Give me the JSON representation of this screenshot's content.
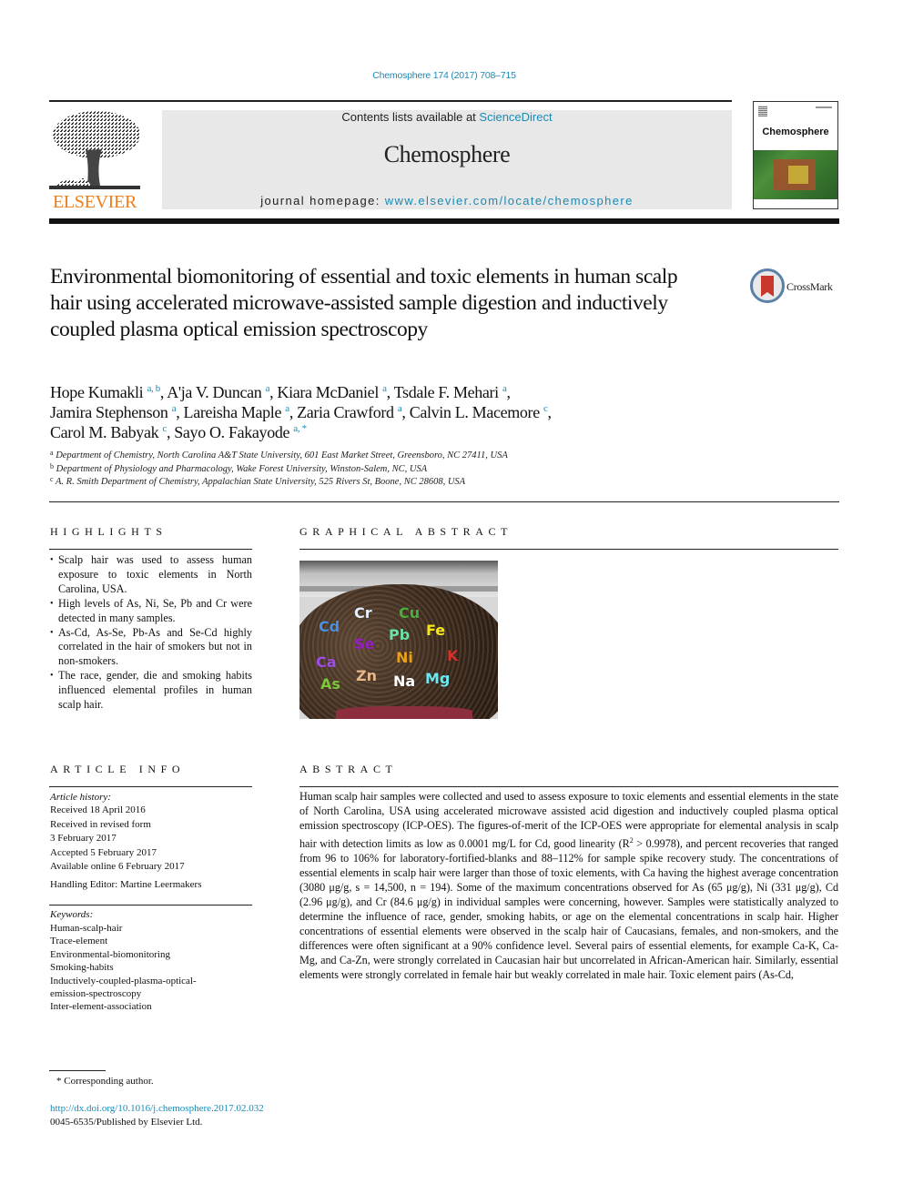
{
  "journal_ref": "Chemosphere 174 (2017) 708–715",
  "banner": {
    "publisher_logo_text": "ELSEVIER",
    "contents_prefix": "Contents lists available at ",
    "contents_link": "ScienceDirect",
    "journal_name": "Chemosphere",
    "homepage_prefix": "journal homepage: ",
    "homepage_link": "www.elsevier.com/locate/chemosphere",
    "cover_title": "Chemosphere"
  },
  "crossmark_label": "CrossMark",
  "article": {
    "title": "Environmental biomonitoring of essential and toxic elements in human scalp hair using accelerated microwave-assisted sample digestion and inductively coupled plasma optical emission spectroscopy",
    "authors": [
      {
        "name": "Hope Kumakli",
        "aff": "a, b",
        "sep": ", "
      },
      {
        "name": "A'ja V. Duncan",
        "aff": "a",
        "sep": ", "
      },
      {
        "name": "Kiara McDaniel",
        "aff": "a",
        "sep": ", "
      },
      {
        "name": "Tsdale F. Mehari",
        "aff": "a",
        "sep": ","
      },
      {
        "name": "Jamira Stephenson",
        "aff": "a",
        "sep": ", "
      },
      {
        "name": "Lareisha Maple",
        "aff": "a",
        "sep": ", "
      },
      {
        "name": "Zaria Crawford",
        "aff": "a",
        "sep": ", "
      },
      {
        "name": "Calvin L. Macemore",
        "aff": "c",
        "sep": ","
      },
      {
        "name": "Carol M. Babyak",
        "aff": "c",
        "sep": ", "
      },
      {
        "name": "Sayo O. Fakayode",
        "aff": "a, *",
        "sep": ""
      }
    ],
    "affiliations": [
      {
        "mark": "a",
        "text": "Department of Chemistry, North Carolina A&T State University, 601 East Market Street, Greensboro, NC 27411, USA"
      },
      {
        "mark": "b",
        "text": "Department of Physiology and Pharmacology, Wake Forest University, Winston-Salem, NC, USA"
      },
      {
        "mark": "c",
        "text": "A. R. Smith Department of Chemistry, Appalachian State University, 525 Rivers St, Boone, NC 28608, USA"
      }
    ]
  },
  "highlights": {
    "heading": "HIGHLIGHTS",
    "items": [
      "Scalp hair was used to assess human exposure to toxic elements in North Carolina, USA.",
      "High levels of As, Ni, Se, Pb and Cr were detected in many samples.",
      "As-Cd, As-Se, Pb-As and Se-Cd highly correlated in the hair of smokers but not in non-smokers.",
      "The race, gender, die and smoking habits influenced elemental profiles in human scalp hair."
    ]
  },
  "graphical_abstract": {
    "heading": "GRAPHICAL ABSTRACT",
    "element_labels": [
      {
        "symbol": "Cr",
        "color": "#e6f0ff"
      },
      {
        "symbol": "Cu",
        "color": "#4caf3c"
      },
      {
        "symbol": "Cd",
        "color": "#4a90e2"
      },
      {
        "symbol": "Fe",
        "color": "#f5e61a"
      },
      {
        "symbol": "Pb",
        "color": "#6ee0a8"
      },
      {
        "symbol": "Se",
        "color": "#9b1fc9"
      },
      {
        "symbol": "Ni",
        "color": "#e8a21a"
      },
      {
        "symbol": "K",
        "color": "#d8302a"
      },
      {
        "symbol": "Ca",
        "color": "#a04ee8"
      },
      {
        "symbol": "Zn",
        "color": "#e8b88a"
      },
      {
        "symbol": "Mg",
        "color": "#6ee8f0"
      },
      {
        "symbol": "Na",
        "color": "#ffffff"
      },
      {
        "symbol": "As",
        "color": "#7cc83a"
      }
    ]
  },
  "article_info": {
    "heading": "ARTICLE INFO",
    "history_label": "Article history:",
    "history": [
      "Received 18 April 2016",
      "Received in revised form",
      "3 February 2017",
      "Accepted 5 February 2017",
      "Available online 6 February 2017"
    ],
    "handling_editor": "Handling Editor: Martine Leermakers",
    "keywords_label": "Keywords:",
    "keywords": [
      "Human-scalp-hair",
      "Trace-element",
      "Environmental-biomonitoring",
      "Smoking-habits",
      "Inductively-coupled-plasma-optical-",
      "emission-spectroscopy",
      "Inter-element-association"
    ]
  },
  "abstract": {
    "heading": "ABSTRACT",
    "part1": "Human scalp hair samples were collected and used to assess exposure to toxic elements and essential elements in the state of North Carolina, USA using accelerated microwave assisted acid digestion and inductively coupled plasma optical emission spectroscopy (ICP-OES). The figures-of-merit of the ICP-OES were appropriate for elemental analysis in scalp hair with detection limits as low as 0.0001 mg/L for Cd, good linearity (R",
    "sup": "2",
    "part2": " > 0.9978), and percent recoveries that ranged from 96 to 106% for laboratory-fortified-blanks and 88–112% for sample spike recovery study. The concentrations of essential elements in scalp hair were larger than those of toxic elements, with Ca having the highest average concentration (3080 μg/g, s = 14,500, n = 194). Some of the maximum concentrations observed for As (65 μg/g), Ni (331 μg/g), Cd (2.96 μg/g), and Cr (84.6 μg/g) in individual samples were concerning, however. Samples were statistically analyzed to determine the influence of race, gender, smoking habits, or age on the elemental concentrations in scalp hair. Higher concentrations of essential elements were observed in the scalp hair of Caucasians, females, and non-smokers, and the differences were often significant at a 90% confidence level. Several pairs of essential elements, for example Ca-K, Ca-Mg, and Ca-Zn, were strongly correlated in Caucasian hair but uncorrelated in African-American hair. Similarly, essential elements were strongly correlated in female hair but weakly correlated in male hair. Toxic element pairs (As-Cd,"
  },
  "footer": {
    "footnote": "* Corresponding author.",
    "doi": "http://dx.doi.org/10.1016/j.chemosphere.2017.02.032",
    "issn_line": "0045-6535/Published by Elsevier Ltd."
  }
}
